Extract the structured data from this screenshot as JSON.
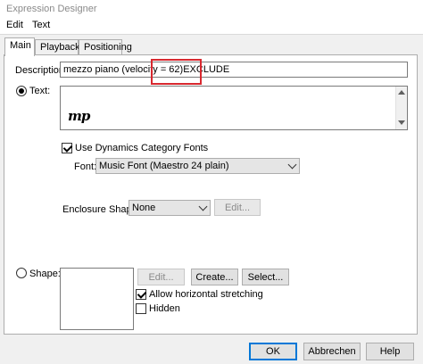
{
  "window": {
    "title": "Expression Designer"
  },
  "menu": {
    "items": [
      "Edit",
      "Text"
    ]
  },
  "tabs": [
    {
      "label": "Main",
      "active": true
    },
    {
      "label": "Playback",
      "active": false
    },
    {
      "label": "Positioning",
      "active": false
    }
  ],
  "description": {
    "label": "Description:",
    "value": "mezzo piano (velocity = 62)EXCLUDE"
  },
  "text_option": {
    "label": "Text:",
    "selected": true,
    "content_glyph": "mp"
  },
  "dynamics_fonts": {
    "label": "Use Dynamics Category Fonts",
    "checked": true
  },
  "font": {
    "label": "Font:",
    "value": "Music Font (Maestro 24 plain)"
  },
  "enclosure": {
    "label": "Enclosure Shape:",
    "value": "None",
    "edit_label": "Edit..."
  },
  "shape_option": {
    "label": "Shape:",
    "selected": false,
    "edit_label": "Edit...",
    "create_label": "Create...",
    "select_label": "Select..."
  },
  "allow_stretching": {
    "label": "Allow horizontal stretching",
    "checked": true
  },
  "hidden": {
    "label": "Hidden",
    "checked": false
  },
  "footer": {
    "ok_label": "OK",
    "cancel_label": "Abbrechen",
    "help_label": "Help"
  },
  "colors": {
    "annotation": "#d8282f",
    "default_button_border": "#0078d7",
    "dialog_background": "#f0f0f0"
  }
}
